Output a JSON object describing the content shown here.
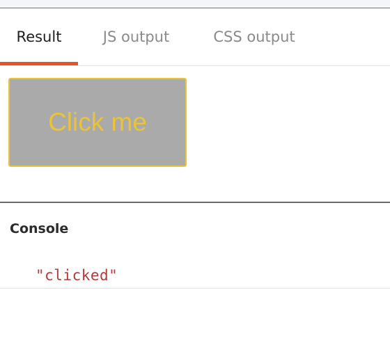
{
  "tabs": [
    {
      "label": "Result",
      "active": true
    },
    {
      "label": "JS output",
      "active": false
    },
    {
      "label": "CSS output",
      "active": false
    }
  ],
  "result": {
    "button_label": "Click me"
  },
  "console": {
    "title": "Console",
    "entries": [
      "\"clicked\""
    ]
  },
  "colors": {
    "accent": "#e8522b",
    "button_bg": "#aaaaaa",
    "button_text": "#e9c33a",
    "console_string": "#b33a3a"
  }
}
